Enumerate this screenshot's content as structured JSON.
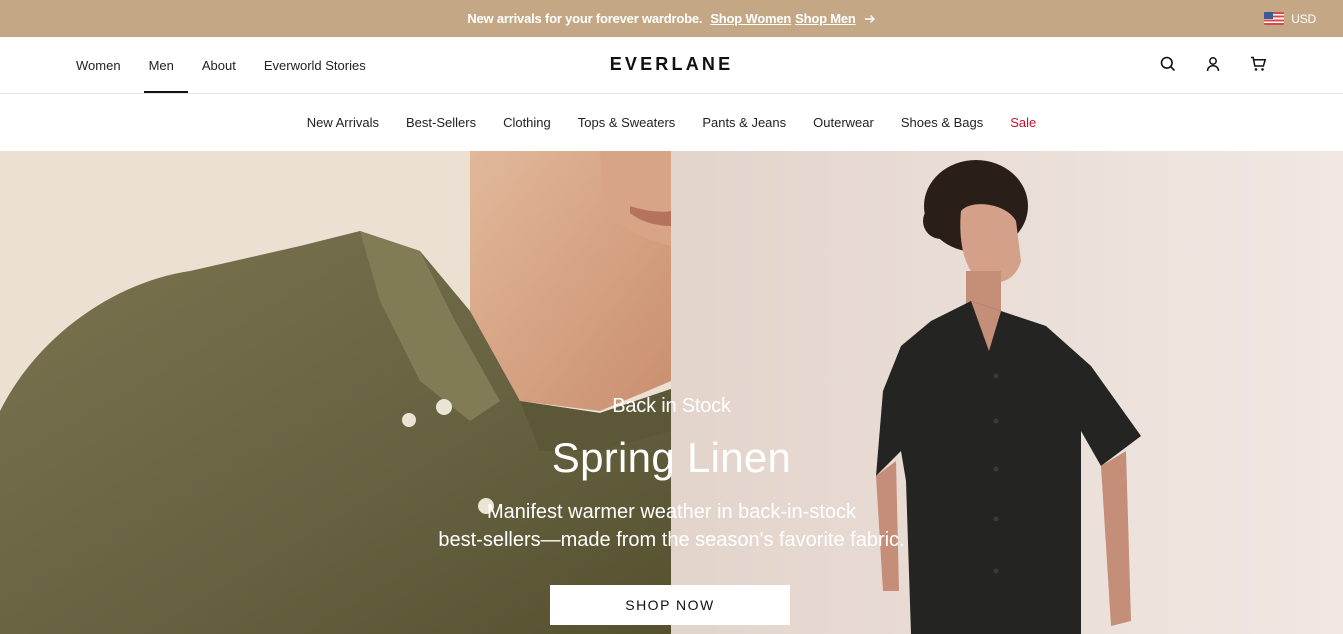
{
  "announcement": {
    "message": "New arrivals for your forever wardrobe.",
    "link_women": "Shop Women",
    "link_men": "Shop Men",
    "arrow_icon": "arrow-right-icon",
    "currency": "USD",
    "flag_icon": "us-flag-icon"
  },
  "header": {
    "nav": [
      "Women",
      "Men",
      "About",
      "Everworld Stories"
    ],
    "active_nav": "Men",
    "logo": "EVERLANE",
    "icons": [
      "search-icon",
      "account-icon",
      "cart-icon"
    ]
  },
  "categories": [
    "New Arrivals",
    "Best-Sellers",
    "Clothing",
    "Tops & Sweaters",
    "Pants & Jeans",
    "Outerwear",
    "Shoes & Bags",
    "Sale"
  ],
  "hero": {
    "eyebrow": "Back in Stock",
    "title": "Spring Linen",
    "description_line1": "Manifest warmer weather in back-in-stock",
    "description_line2": "best-sellers—made from the season's favorite fabric.",
    "cta": "SHOP NOW"
  },
  "colors": {
    "announcement_bg": "#c4a886",
    "sale": "#c8102e",
    "shirt_olive": "#6e6a45",
    "shirt_black": "#222222"
  }
}
